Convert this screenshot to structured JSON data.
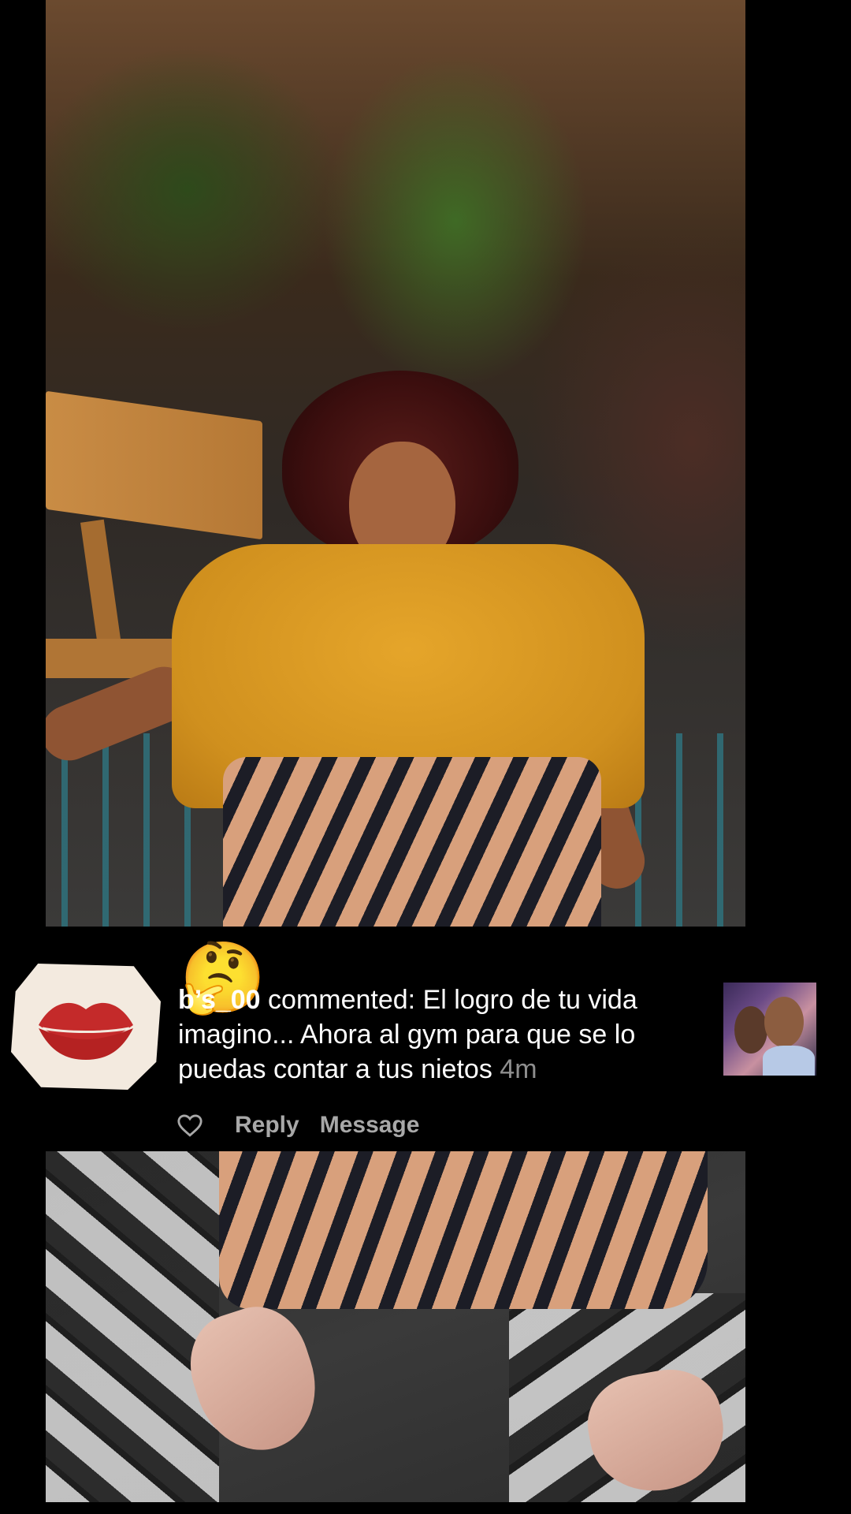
{
  "comment": {
    "username": "b’s_00",
    "action_text": " commented: ",
    "body": "El logro de tu vida imagino... Ahora al gym para que se lo puedas contar a tus nietos",
    "timestamp": "4m",
    "avatar_icon": "lips-sticker-icon",
    "overlay_emoji": "🤔"
  },
  "actions": {
    "like_icon": "heart-icon",
    "reply_label": "Reply",
    "message_label": "Message"
  },
  "colors": {
    "background": "#000000",
    "text_primary": "#ffffff",
    "text_secondary": "#8e8e8e",
    "action_text": "#a8a8a8",
    "blouse": "#d89a22",
    "lips": "#c42a2a"
  }
}
